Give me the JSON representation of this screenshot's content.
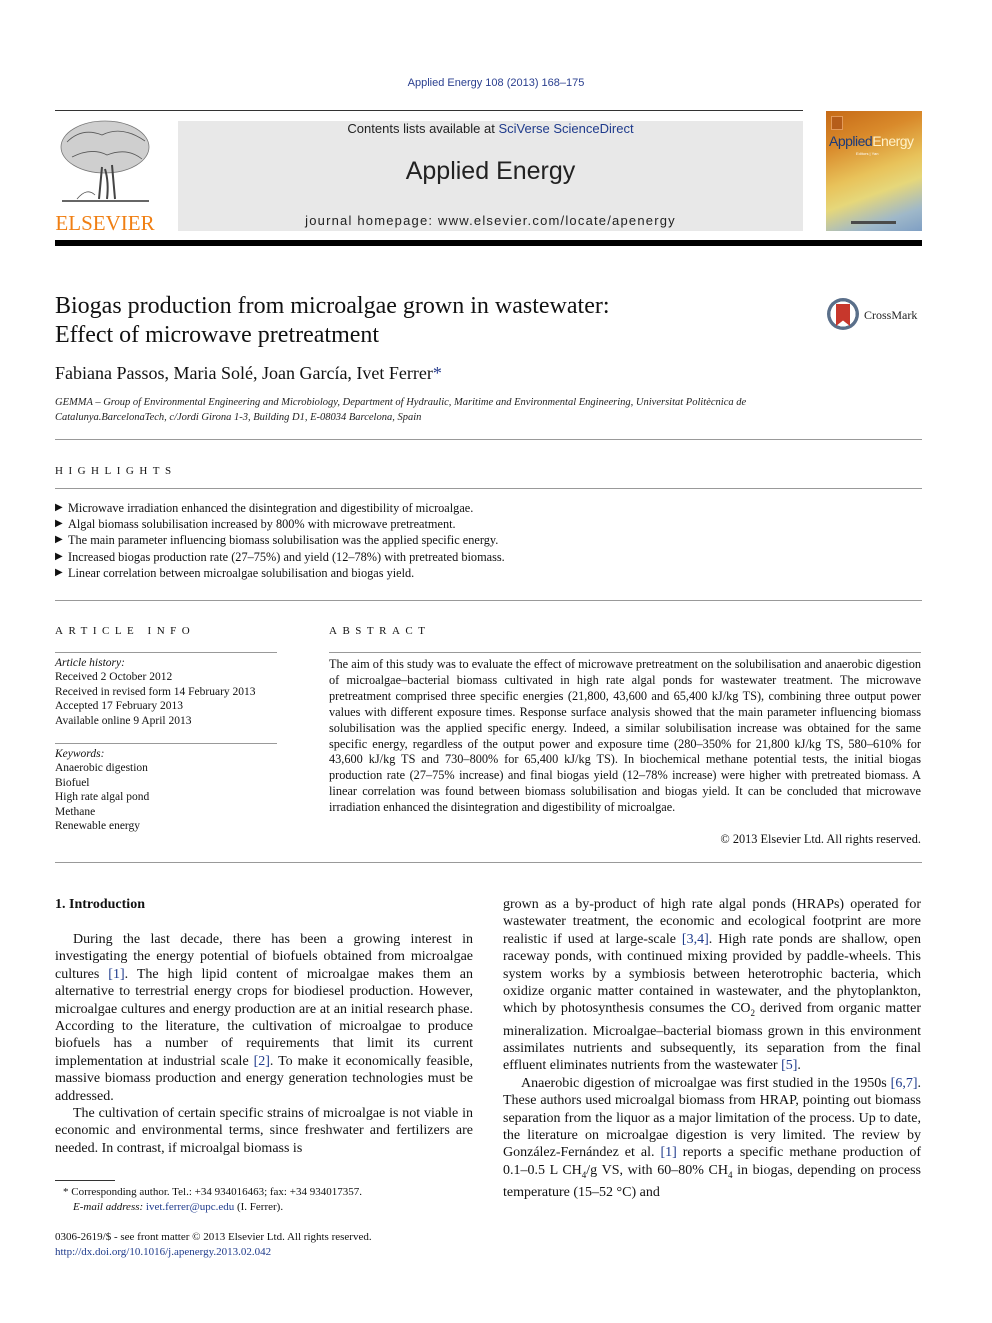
{
  "header": {
    "citation": "Applied Energy 108 (2013) 168–175",
    "contents_prefix": "Contents lists available at ",
    "contents_link": "SciVerse ScienceDirect",
    "journal_name": "Applied Energy",
    "homepage": "journal homepage: www.elsevier.com/locate/apenergy",
    "publisher_logo_text": "ELSEVIER",
    "cover_title_part1": "Applied",
    "cover_title_part2": "Energy",
    "cover_subtitle": "Editors | Yan",
    "colors": {
      "elsevier_orange": "#f07f13",
      "link_blue": "#1f3b8c",
      "band_gray": "#e8e8e8"
    }
  },
  "article": {
    "title_line1": "Biogas production from microalgae grown in wastewater:",
    "title_line2": "Effect of microwave pretreatment",
    "crossmark_label": "CrossMark",
    "authors": "Fabiana Passos, Maria Solé, Joan García, Ivet Ferrer",
    "author_star": "*",
    "affiliation_line1": "GEMMA – Group of Environmental Engineering and Microbiology, Department of Hydraulic, Maritime and Environmental Engineering, Universitat Politècnica de",
    "affiliation_line2": "Catalunya.BarcelonaTech, c/Jordi Girona 1-3, Building D1, E-08034 Barcelona, Spain"
  },
  "highlights": {
    "heading": "HIGHLIGHTS",
    "items": [
      "Microwave irradiation enhanced the disintegration and digestibility of microalgae.",
      "Algal biomass solubilisation increased by 800% with microwave pretreatment.",
      "The main parameter influencing biomass solubilisation was the applied specific energy.",
      "Increased biogas production rate (27–75%) and yield (12–78%) with pretreated biomass.",
      "Linear correlation between microalgae solubilisation and biogas yield."
    ]
  },
  "article_info": {
    "heading": "ARTICLE INFO",
    "history_label": "Article history:",
    "history": [
      "Received 2 October 2012",
      "Received in revised form 14 February 2013",
      "Accepted 17 February 2013",
      "Available online 9 April 2013"
    ],
    "keywords_label": "Keywords:",
    "keywords": [
      "Anaerobic digestion",
      "Biofuel",
      "High rate algal pond",
      "Methane",
      "Renewable energy"
    ]
  },
  "abstract": {
    "heading": "ABSTRACT",
    "text": "The aim of this study was to evaluate the effect of microwave pretreatment on the solubilisation and anaerobic digestion of microalgae–bacterial biomass cultivated in high rate algal ponds for wastewater treatment. The microwave pretreatment comprised three specific energies (21,800, 43,600 and 65,400 kJ/kg TS), combining three output power values with different exposure times. Response surface analysis showed that the main parameter influencing biomass solubilisation was the applied specific energy. Indeed, a similar solubilisation increase was obtained for the same specific energy, regardless of the output power and exposure time (280–350% for 21,800 kJ/kg TS, 580–610% for 43,600 kJ/kg TS and 730–800% for 65,400 kJ/kg TS). In biochemical methane potential tests, the initial biogas production rate (27–75% increase) and final biogas yield (12–78% increase) were higher with pretreated biomass. A linear correlation was found between biomass solubilisation and biogas yield. It can be concluded that microwave irradiation enhanced the disintegration and digestibility of microalgae.",
    "copyright": "© 2013 Elsevier Ltd. All rights reserved."
  },
  "introduction": {
    "heading": "1. Introduction",
    "p1_a": "During the last decade, there has been a growing interest in investigating the energy potential of biofuels obtained from microalgae cultures ",
    "p1_ref1": "[1]",
    "p1_b": ". The high lipid content of microalgae makes them an alternative to terrestrial energy crops for biodiesel production. However, microalgae cultures and energy production are at an initial research phase. According to the literature, the cultivation of microalgae to produce biofuels has a number of requirements that limit its current implementation at industrial scale ",
    "p1_ref2": "[2]",
    "p1_c": ". To make it economically feasible, massive biomass production and energy generation technologies must be addressed.",
    "p2": "The cultivation of certain specific strains of microalgae is not viable in economic and environmental terms, since freshwater and fertilizers are needed. In contrast, if microalgal biomass is",
    "p2_cont_a": "grown as a by-product of high rate algal ponds (HRAPs) operated for wastewater treatment, the economic and ecological footprint are more realistic if used at large-scale ",
    "p2_ref34": "[3,4]",
    "p2_cont_b": ". High rate ponds are shallow, open raceway ponds, with continued mixing provided by paddle-wheels. This system works by a symbiosis between heterotrophic bacteria, which oxidize organic matter contained in wastewater, and the phytoplankton, which by photosynthesis consumes the CO",
    "p2_sub2": "2",
    "p2_cont_c": " derived from organic matter mineralization. Microalgae–bacterial biomass grown in this environment assimilates nutrients and subsequently, its separation from the final effluent eliminates nutrients from the wastewater ",
    "p2_ref5": "[5]",
    "p2_cont_d": ".",
    "p3_a": "Anaerobic digestion of microalgae was first studied in the 1950s ",
    "p3_ref67": "[6,7]",
    "p3_b": ". These authors used microalgal biomass from HRAP, pointing out biomass separation from the liquor as a major limitation of the process. Up to date, the literature on microalgae digestion is very limited. The review by González-Fernández et al. ",
    "p3_ref1": "[1]",
    "p3_c": " reports a specific methane production of 0.1–0.5 L CH",
    "p3_sub4a": "4",
    "p3_d": "/g VS, with 60–80% CH",
    "p3_sub4b": "4",
    "p3_e": " in biogas, depending on process temperature (15–52 °C) and"
  },
  "footnote": {
    "star": "*",
    "corresponding": " Corresponding author. Tel.: +34 934016463; fax: +34 934017357.",
    "email_label": "E-mail address:",
    "email": "ivet.ferrer@upc.edu",
    "email_suffix": " (I. Ferrer).",
    "front_matter": "0306-2619/$ - see front matter © 2013 Elsevier Ltd. All rights reserved.",
    "doi": "http://dx.doi.org/10.1016/j.apenergy.2013.02.042"
  }
}
